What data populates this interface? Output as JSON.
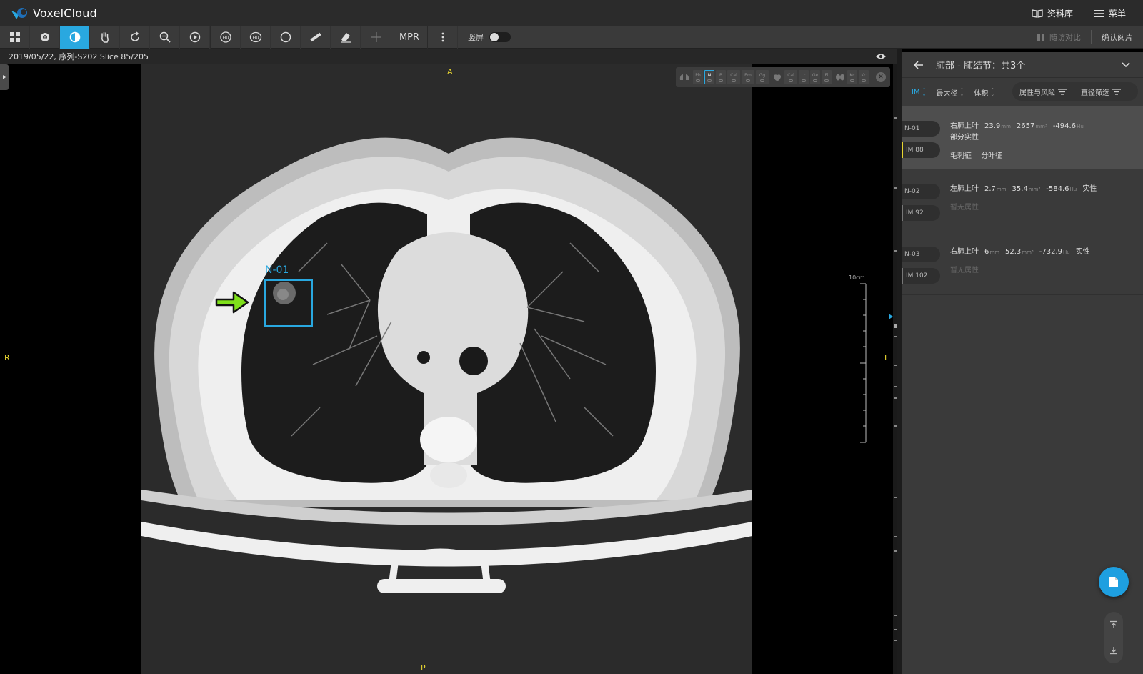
{
  "header": {
    "brand": "VoxelCloud",
    "library_label": "资料库",
    "menu_label": "菜单"
  },
  "toolbar": {
    "mpr_label": "MPR",
    "vertical_label": "竖屏",
    "follow_compare_label": "随访对比",
    "confirm_label": "确认阅片"
  },
  "viewer": {
    "info": "2019/05/22, 序列-S202 Slice 85/205",
    "orient_top": "A",
    "orient_bottom": "P",
    "orient_left": "R",
    "orient_right": "L",
    "scale_label": "10cm",
    "roi_label": "N-01",
    "filters": [
      "Pb",
      "N",
      "B",
      "Cal",
      "Em",
      "Gg",
      "Cal",
      "Lc",
      "Ge",
      "Fl",
      "Kc",
      "Kc"
    ],
    "filter_selected_index": 1
  },
  "panel": {
    "title": "肺部 - 肺结节：共3个",
    "sort": {
      "im": "IM",
      "max_diameter": "最大径",
      "volume": "体积",
      "attr_risk": "属性与风险",
      "diameter_filter": "直径筛选"
    },
    "nodules": [
      {
        "id": "N-01",
        "im": "IM 88",
        "location": "右肺上叶",
        "diameter": "23.9",
        "diameter_unit": "mm",
        "volume": "2657",
        "volume_unit": "mm³",
        "hu": "-494.6",
        "hu_unit": "Hu",
        "type_line": "部分实性",
        "attr1": "毛刺征",
        "attr2": "分叶征",
        "selected": true
      },
      {
        "id": "N-02",
        "im": "IM 92",
        "location": "左肺上叶",
        "diameter": "2.7",
        "diameter_unit": "mm",
        "volume": "35.4",
        "volume_unit": "mm³",
        "hu": "-584.6",
        "hu_unit": "Hu",
        "type": "实性",
        "attr_line": "暂无属性"
      },
      {
        "id": "N-03",
        "im": "IM 102",
        "location": "右肺上叶",
        "diameter": "6",
        "diameter_unit": "mm",
        "volume": "52.3",
        "volume_unit": "mm³",
        "hu": "-732.9",
        "hu_unit": "Hu",
        "type": "实性",
        "attr_line": "暂无属性"
      }
    ]
  },
  "colors": {
    "accent": "#29a8e0",
    "marker_yellow": "#e8d630",
    "arrow_green": "#7fe01a",
    "roi_blue": "#29a8e0"
  }
}
